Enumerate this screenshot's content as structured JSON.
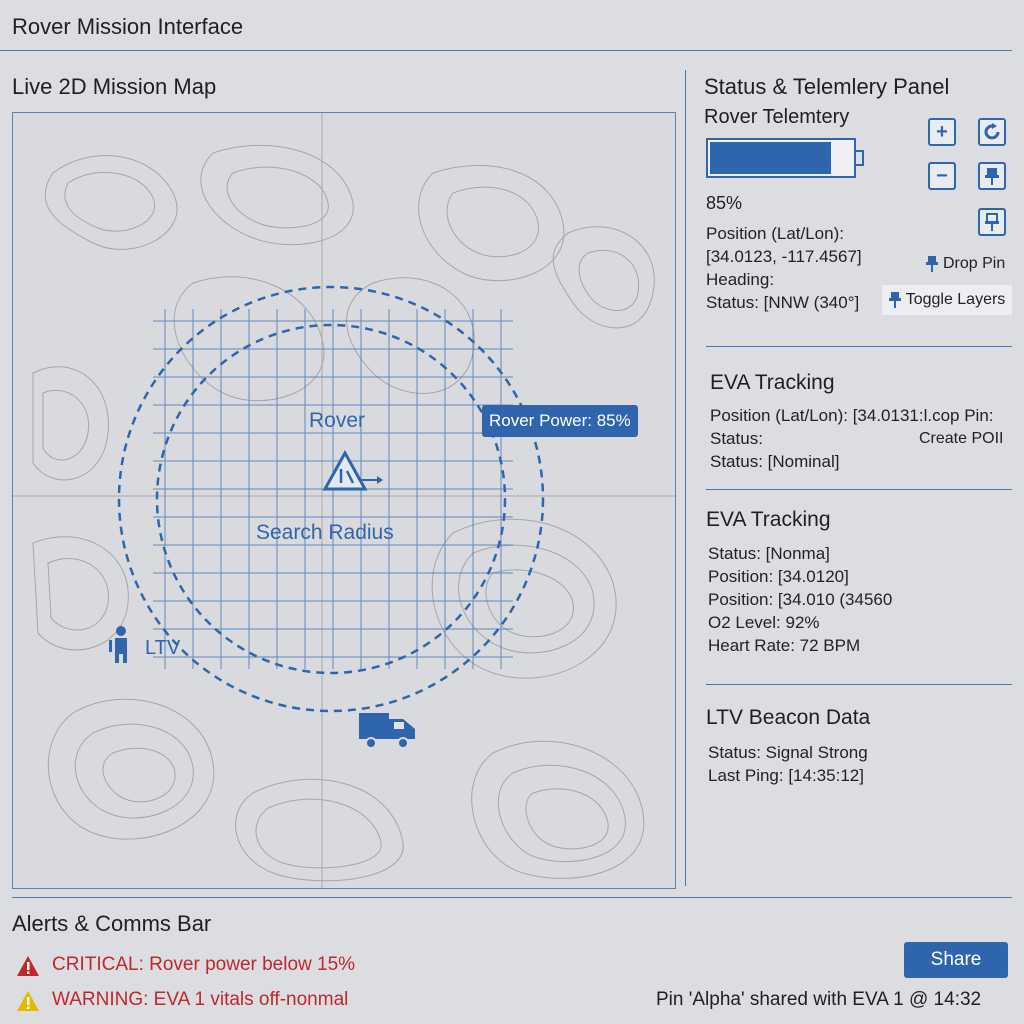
{
  "app": {
    "title": "Rover Mission Interface"
  },
  "map": {
    "title": "Live 2D Mission Map",
    "rover_label": "Rover",
    "radius_label": "Search Radius",
    "power_tooltip": "Rover Power: 85%",
    "ltv_label": "LTV"
  },
  "status": {
    "title": "Status & Telemlery Panel",
    "telemetry_title": "Rover Telemtery",
    "battery_level": 0.85,
    "battery_text": "85%",
    "position_label": "Position (Lat/Lon):",
    "position_value": "[34.0123, -117.4567]",
    "heading_label": "Heading:",
    "status_line": "Status: [NNW (340°]",
    "controls": {
      "zoom_in": "+",
      "refresh_icon": "refresh-icon",
      "zoom_out": "−",
      "pin_icon": "pin-icon",
      "pin_alt_icon": "pin-outline-icon",
      "drop_pin": "Drop Pin",
      "toggle_layers": "Toggle Layers"
    }
  },
  "eva1": {
    "title": "EVA Tracking",
    "position": "Position (Lat/Lon): [34.0131:l.cop Pin:",
    "status_label": "Status:",
    "create_poi": "Create POII",
    "status_value": "Status: [Nominal]"
  },
  "eva2": {
    "title": "EVA Tracking",
    "lines": [
      "Status: [Nonma]",
      "Position: [34.0120]",
      "Position: [34.010 (34560",
      "O2 Level: 92%",
      "Heart Rate: 72 BPM"
    ]
  },
  "ltv": {
    "title": "LTV Beacon Data",
    "status": "Status: Signal Strong",
    "last_ping": "Last Ping: [14:35:12]"
  },
  "alerts": {
    "title": "Alerts & Comms Bar",
    "critical": "CRITICAL: Rover power below 15%",
    "warning": "WARNING: EVA 1 vitals off-nonmal",
    "share_label": "Share",
    "share_message": "Pin 'Alpha' shared with EVA 1 @ 14:32"
  },
  "colors": {
    "accent": "#2e65ad",
    "critical": "#c0272d",
    "warning": "#e6b800",
    "background": "#dcdde0"
  }
}
